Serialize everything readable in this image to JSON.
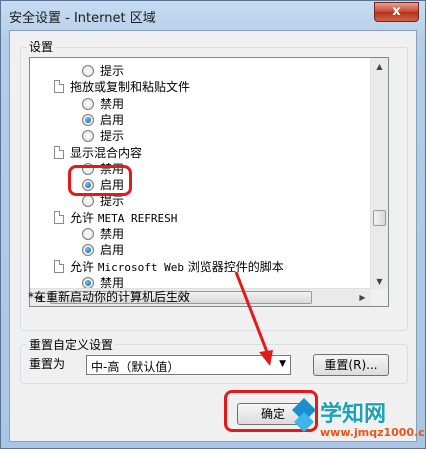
{
  "window": {
    "title": "安全设置 - Internet 区域",
    "close_glyph": "x"
  },
  "settings_group": {
    "legend": "设置"
  },
  "tree_rows": [
    {
      "kind": "radio",
      "label": "提示",
      "checked": false
    },
    {
      "kind": "heading",
      "label": "拖放或复制和粘贴文件"
    },
    {
      "kind": "radio",
      "label": "禁用",
      "checked": false
    },
    {
      "kind": "radio",
      "label": "启用",
      "checked": true
    },
    {
      "kind": "radio",
      "label": "提示",
      "checked": false
    },
    {
      "kind": "heading",
      "label": "显示混合内容"
    },
    {
      "kind": "radio",
      "label": "禁用",
      "checked": false
    },
    {
      "kind": "radio",
      "label": "启用",
      "checked": true
    },
    {
      "kind": "radio",
      "label": "提示",
      "checked": false
    },
    {
      "kind": "heading",
      "label_cn": "允许",
      "label_mono": "META REFRESH"
    },
    {
      "kind": "radio",
      "label": "禁用",
      "checked": false
    },
    {
      "kind": "radio",
      "label": "启用",
      "checked": true
    },
    {
      "kind": "heading",
      "label_cn": "允许",
      "label_mono": "Microsoft Web",
      "label_tail": "浏览器控件的脚本"
    },
    {
      "kind": "radio",
      "label": "禁用",
      "checked": true
    }
  ],
  "restart_note": "*在重新启动你的计算机后生效",
  "reset_group": {
    "legend": "重置自定义设置",
    "reset_to_label": "重置为"
  },
  "reset_combo": {
    "value": "中-高（默认值）"
  },
  "buttons": {
    "reset": "重置(R)...",
    "ok": "确定"
  },
  "watermark": {
    "title": "学知网",
    "url": "www.jmqz1000.com"
  },
  "colors": {
    "annotation_red": "#e01b1b",
    "radio_selected": "#0e5fa8",
    "watermark_teal": "#19a3b5",
    "watermark_orange": "#e2571a"
  }
}
